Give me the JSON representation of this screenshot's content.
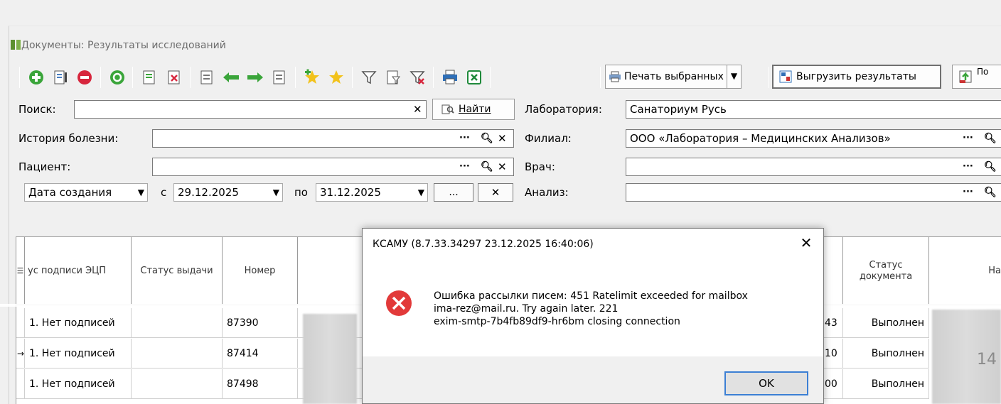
{
  "window": {
    "title": "Документы: Результаты исследований"
  },
  "toolbar": {
    "print_selected": "Печать выбранных",
    "export_results": "Выгрузить результаты",
    "cut_label": "По"
  },
  "filters": {
    "search_label": "Поиск:",
    "find_button": "Найти",
    "history_label": "История болезни:",
    "patient_label": "Пациент:",
    "date_type": "Дата создания",
    "from_label": "с",
    "date_from": "29.12.2025",
    "to_label": "по",
    "date_to": "31.12.2025",
    "ellipsis_button": "...",
    "lab_label": "Лаборатория:",
    "lab_value": "Санаториум Русь",
    "branch_label": "Филиал:",
    "branch_value": "ООО «Лаборатория – Медицинских Анализов»",
    "doctor_label": "Врач:",
    "analysis_label": "Анализ:"
  },
  "grid": {
    "headers": {
      "sign_status": "ус подписи ЭЦП",
      "issue_status": "Статус выдачи",
      "number": "Номер",
      "doc_status": "Статус документа",
      "name_cut": "На"
    },
    "rows": [
      {
        "sign": "1. Нет подписей",
        "number": "87390",
        "mid": "43",
        "status": "Выполнен",
        "marker": ""
      },
      {
        "sign": "1. Нет подписей",
        "number": "87414",
        "mid": "10",
        "status": "Выполнен",
        "marker": "→"
      },
      {
        "sign": "1. Нет подписей",
        "number": "87498",
        "mid": "00",
        "status": "Выполнен",
        "marker": ""
      }
    ],
    "edge_number": "14"
  },
  "dialog": {
    "title": "КСАМУ (8.7.33.34297 23.12.2025 16:40:06)",
    "message": "Ошибка рассылки писем: 451 Ratelimit exceeded for mailbox\nima-rez@mail.ru. Try again later. 221\nexim-smtp-7b4fb89df9-hr6bm closing connection",
    "ok": "OK"
  }
}
